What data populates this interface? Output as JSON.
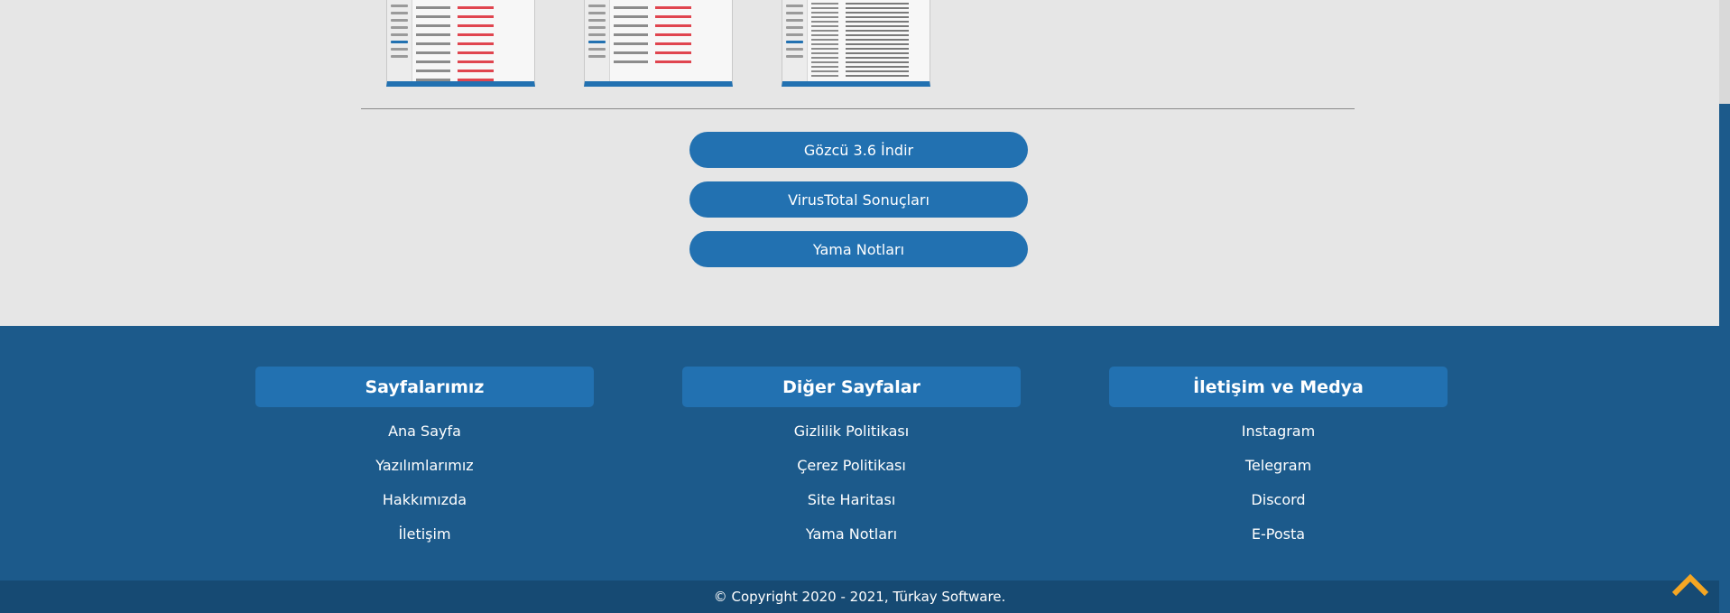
{
  "colors": {
    "accent": "#2271b1",
    "footer_bg": "#1c5a8b",
    "copyright_bg": "#164a73",
    "page_bg": "#e6e6e6",
    "top_arrow": "#f5a623"
  },
  "thumbnails": [
    {
      "icon": "screenshot-thumbnail"
    },
    {
      "icon": "screenshot-thumbnail"
    },
    {
      "icon": "screenshot-thumbnail"
    }
  ],
  "actions": {
    "download_label": "Gözcü 3.6 İndir",
    "virustotal_label": "VirusTotal Sonuçları",
    "patch_notes_label": "Yama Notları"
  },
  "footer": {
    "columns": [
      {
        "title": "Sayfalarımız",
        "links": [
          "Ana Sayfa",
          "Yazılımlarımız",
          "Hakkımızda",
          "İletişim"
        ]
      },
      {
        "title": "Diğer Sayfalar",
        "links": [
          "Gizlilik Politikası",
          "Çerez Politikası",
          "Site Haritası",
          "Yama Notları"
        ]
      },
      {
        "title": "İletişim ve Medya",
        "links": [
          "Instagram",
          "Telegram",
          "Discord",
          "E-Posta"
        ]
      }
    ],
    "copyright": "© Copyright 2020 - 2021, Türkay Software."
  },
  "back_to_top_icon": "chevron-up-icon"
}
